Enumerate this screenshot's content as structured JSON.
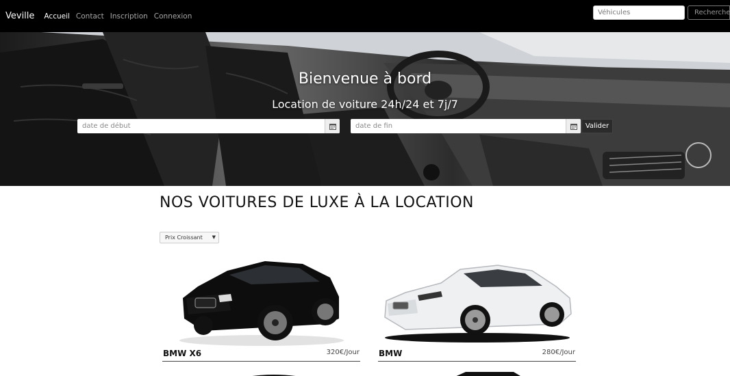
{
  "navbar": {
    "brand": "Veville",
    "links": [
      "Accueil",
      "Contact",
      "Inscription",
      "Connexion"
    ],
    "search_placeholder": "Véhicules",
    "search_button": "Recherche"
  },
  "hero": {
    "title": "Bienvenue à bord",
    "subtitle": "Location de voiture 24h/24 et 7j/7",
    "start_placeholder": "date de début",
    "end_placeholder": "date de fin",
    "submit_label": "Valider"
  },
  "catalog": {
    "heading": "NOS VOITURES DE LUXE À LA LOCATION",
    "sort_selected": "Prix Croissant",
    "cars": [
      {
        "name": "BMW X6",
        "price": "320€/Jour",
        "color": "#0d0d0d"
      },
      {
        "name": "BMW",
        "price": "280€/Jour",
        "color": "#eef0f2"
      }
    ]
  }
}
